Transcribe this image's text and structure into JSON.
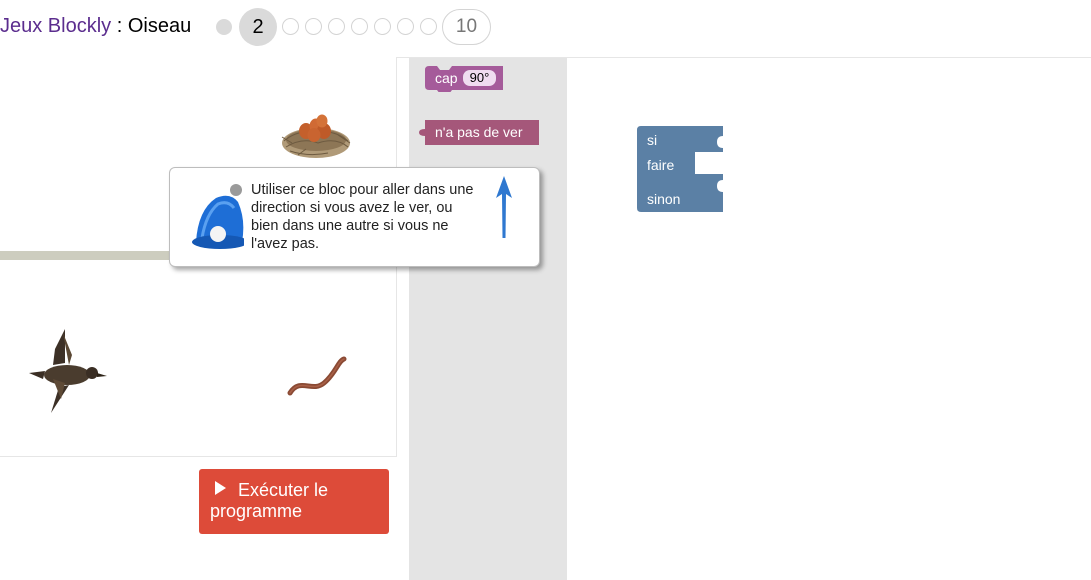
{
  "header": {
    "app_name": "Jeux Blockly",
    "separator": " : ",
    "game_name": "Oiseau",
    "levels": {
      "current": "2",
      "last": "10"
    }
  },
  "run_button": {
    "label": "Exécuter le programme",
    "icon": "play-icon"
  },
  "toolbox": {
    "heading_block": {
      "label": "cap",
      "value": "90°",
      "color": "#a55b9a"
    },
    "no_worm_block": {
      "label": "n'a pas de ver",
      "color": "#a5577a"
    }
  },
  "workspace": {
    "if_else_block": {
      "if_label": "si",
      "do_label": "faire",
      "else_label": "sinon",
      "color": "#5b80a5"
    }
  },
  "tooltip": {
    "text": "Utiliser ce bloc pour aller dans une direction si vous avez le ver, ou bien dans une autre si vous ne l'avez pas.",
    "icon": "bell-icon",
    "arrow_icon": "arrow-up-icon"
  },
  "colors": {
    "link": "#5b2d8e",
    "run_button": "#dd4b39",
    "toolbox_bg": "#e4e4e4",
    "wall": "#cdcdbf"
  }
}
